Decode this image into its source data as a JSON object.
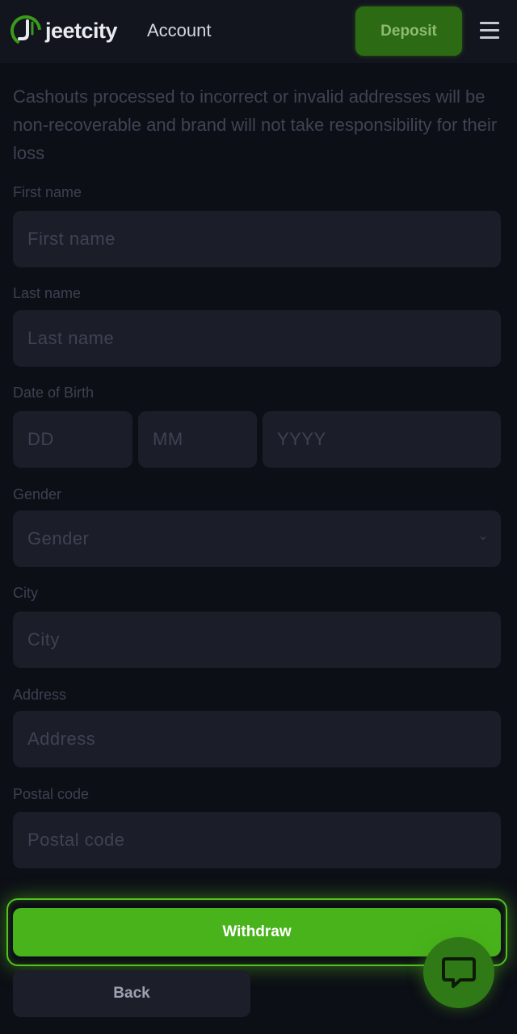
{
  "header": {
    "brand": "jeetcity",
    "section_title": "Account",
    "deposit_label": "Deposit",
    "menu_icon": "hamburger-icon"
  },
  "notice": "Cashouts processed to incorrect or invalid addresses will be non-recoverable and brand will not take responsibility for their loss",
  "form": {
    "first_name": {
      "label": "First name",
      "placeholder": "First name",
      "value": ""
    },
    "last_name": {
      "label": "Last name",
      "placeholder": "Last name",
      "value": ""
    },
    "dob": {
      "label": "Date of Birth",
      "day_placeholder": "DD",
      "month_placeholder": "MM",
      "year_placeholder": "YYYY"
    },
    "gender": {
      "label": "Gender",
      "selected": "Gender"
    },
    "city": {
      "label": "City",
      "placeholder": "City",
      "value": ""
    },
    "address": {
      "label": "Address",
      "placeholder": "Address",
      "value": ""
    },
    "postal_code": {
      "label": "Postal code",
      "placeholder": "Postal code",
      "value": ""
    }
  },
  "actions": {
    "withdraw_label": "Withdraw",
    "back_label": "Back",
    "chat_icon": "chat-icon"
  },
  "colors": {
    "accent_green": "#48b31a",
    "background": "#0d0f16",
    "field_bg": "#1b1d29"
  }
}
